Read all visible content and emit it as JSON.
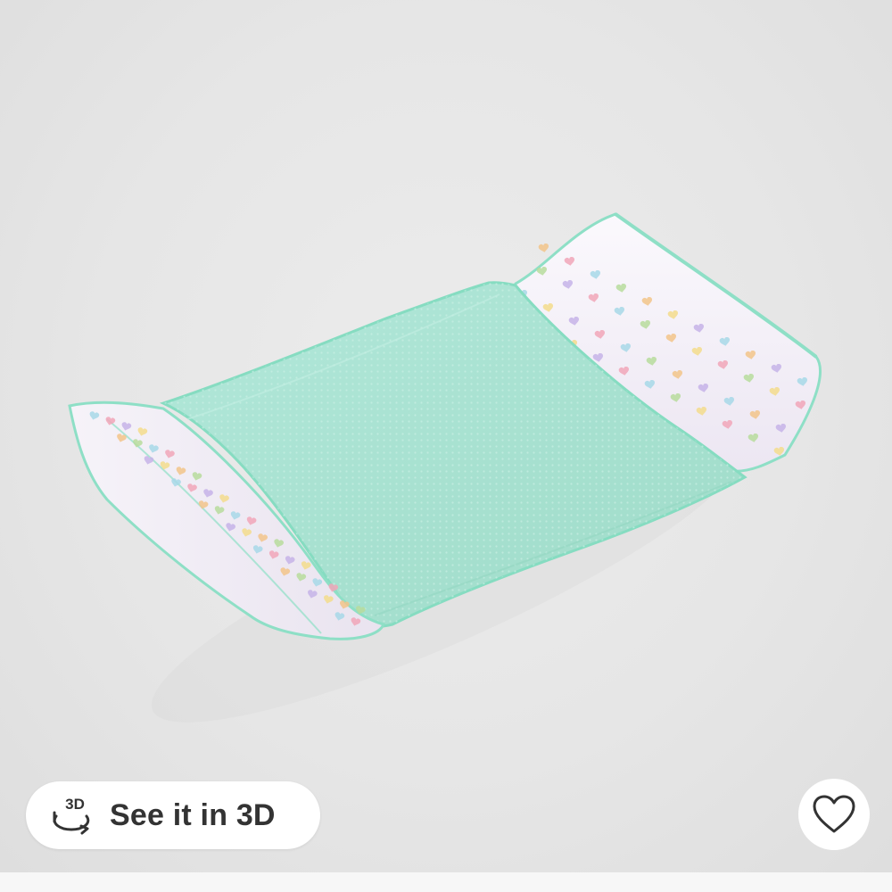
{
  "viewer": {
    "background_color": "#e8e8e8",
    "product": {
      "mesh_color": "#a9e3d3",
      "trim_color": "#7fd9bc",
      "pillow_color": "#f7f4fb",
      "heart_colors": [
        "#f2c48a",
        "#b7dc9c",
        "#a7d8e8",
        "#f1a6b9",
        "#c5b3e8",
        "#f3dc8c"
      ]
    }
  },
  "see_3d_button": {
    "icon_text": "3D",
    "label": "See it in 3D",
    "icon": "rotate-3d-icon"
  },
  "favorite_button": {
    "icon": "heart-outline-icon"
  }
}
